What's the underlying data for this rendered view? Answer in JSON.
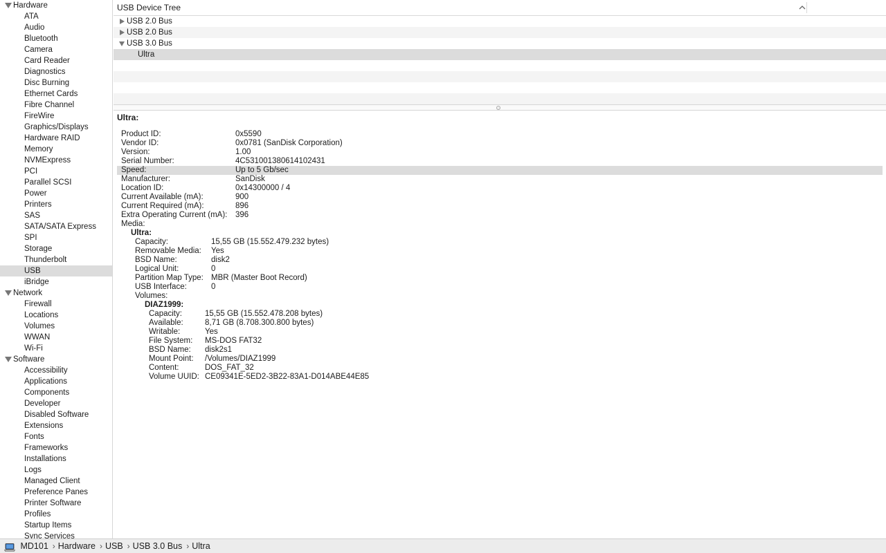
{
  "sidebar": {
    "groups": [
      {
        "label": "Hardware",
        "items": [
          "ATA",
          "Audio",
          "Bluetooth",
          "Camera",
          "Card Reader",
          "Diagnostics",
          "Disc Burning",
          "Ethernet Cards",
          "Fibre Channel",
          "FireWire",
          "Graphics/Displays",
          "Hardware RAID",
          "Memory",
          "NVMExpress",
          "PCI",
          "Parallel SCSI",
          "Power",
          "Printers",
          "SAS",
          "SATA/SATA Express",
          "SPI",
          "Storage",
          "Thunderbolt",
          "USB",
          "iBridge"
        ]
      },
      {
        "label": "Network",
        "items": [
          "Firewall",
          "Locations",
          "Volumes",
          "WWAN",
          "Wi-Fi"
        ]
      },
      {
        "label": "Software",
        "items": [
          "Accessibility",
          "Applications",
          "Components",
          "Developer",
          "Disabled Software",
          "Extensions",
          "Fonts",
          "Frameworks",
          "Installations",
          "Logs",
          "Managed Client",
          "Preference Panes",
          "Printer Software",
          "Profiles",
          "Startup Items",
          "Sync Services"
        ]
      }
    ],
    "selected": "USB"
  },
  "tree": {
    "title": "USB Device Tree",
    "rows": [
      {
        "label": "USB 2.0 Bus",
        "expanded": false
      },
      {
        "label": "USB 2.0 Bus",
        "expanded": false
      },
      {
        "label": "USB 3.0 Bus",
        "expanded": true
      },
      {
        "label": "Ultra",
        "child": true,
        "selected": true
      }
    ]
  },
  "detail": {
    "title": "Ultra:",
    "props": [
      {
        "k": "Product ID:",
        "v": "0x5590"
      },
      {
        "k": "Vendor ID:",
        "v": "0x0781  (SanDisk Corporation)"
      },
      {
        "k": "Version:",
        "v": "1.00"
      },
      {
        "k": "Serial Number:",
        "v": "4C531001380614102431"
      },
      {
        "k": "Speed:",
        "v": "Up to 5 Gb/sec",
        "highlight": true
      },
      {
        "k": "Manufacturer:",
        "v": "SanDisk"
      },
      {
        "k": "Location ID:",
        "v": "0x14300000 / 4"
      },
      {
        "k": "Current Available (mA):",
        "v": "900"
      },
      {
        "k": "Current Required (mA):",
        "v": "896"
      },
      {
        "k": "Extra Operating Current (mA):",
        "v": "396"
      },
      {
        "k": "Media:",
        "v": ""
      }
    ],
    "media_title": "Ultra:",
    "media": [
      {
        "k": "Capacity:",
        "v": "15,55 GB (15.552.479.232 bytes)"
      },
      {
        "k": "Removable Media:",
        "v": "Yes"
      },
      {
        "k": "BSD Name:",
        "v": "disk2"
      },
      {
        "k": "Logical Unit:",
        "v": "0"
      },
      {
        "k": "Partition Map Type:",
        "v": "MBR (Master Boot Record)"
      },
      {
        "k": "USB Interface:",
        "v": "0"
      },
      {
        "k": "Volumes:",
        "v": ""
      }
    ],
    "volume_title": "DIAZ1999:",
    "volume": [
      {
        "k": "Capacity:",
        "v": "15,55 GB (15.552.478.208 bytes)"
      },
      {
        "k": "Available:",
        "v": "8,71 GB (8.708.300.800 bytes)"
      },
      {
        "k": "Writable:",
        "v": "Yes"
      },
      {
        "k": "File System:",
        "v": "MS-DOS FAT32"
      },
      {
        "k": "BSD Name:",
        "v": "disk2s1"
      },
      {
        "k": "Mount Point:",
        "v": "/Volumes/DIAZ1999"
      },
      {
        "k": "Content:",
        "v": "DOS_FAT_32"
      },
      {
        "k": "Volume UUID:",
        "v": "CE09341E-5ED2-3B22-83A1-D014ABE44E85"
      }
    ]
  },
  "breadcrumb": {
    "icon": "computer-icon",
    "items": [
      "MD101",
      "Hardware",
      "USB",
      "USB 3.0 Bus",
      "Ultra"
    ],
    "separator": "›"
  }
}
